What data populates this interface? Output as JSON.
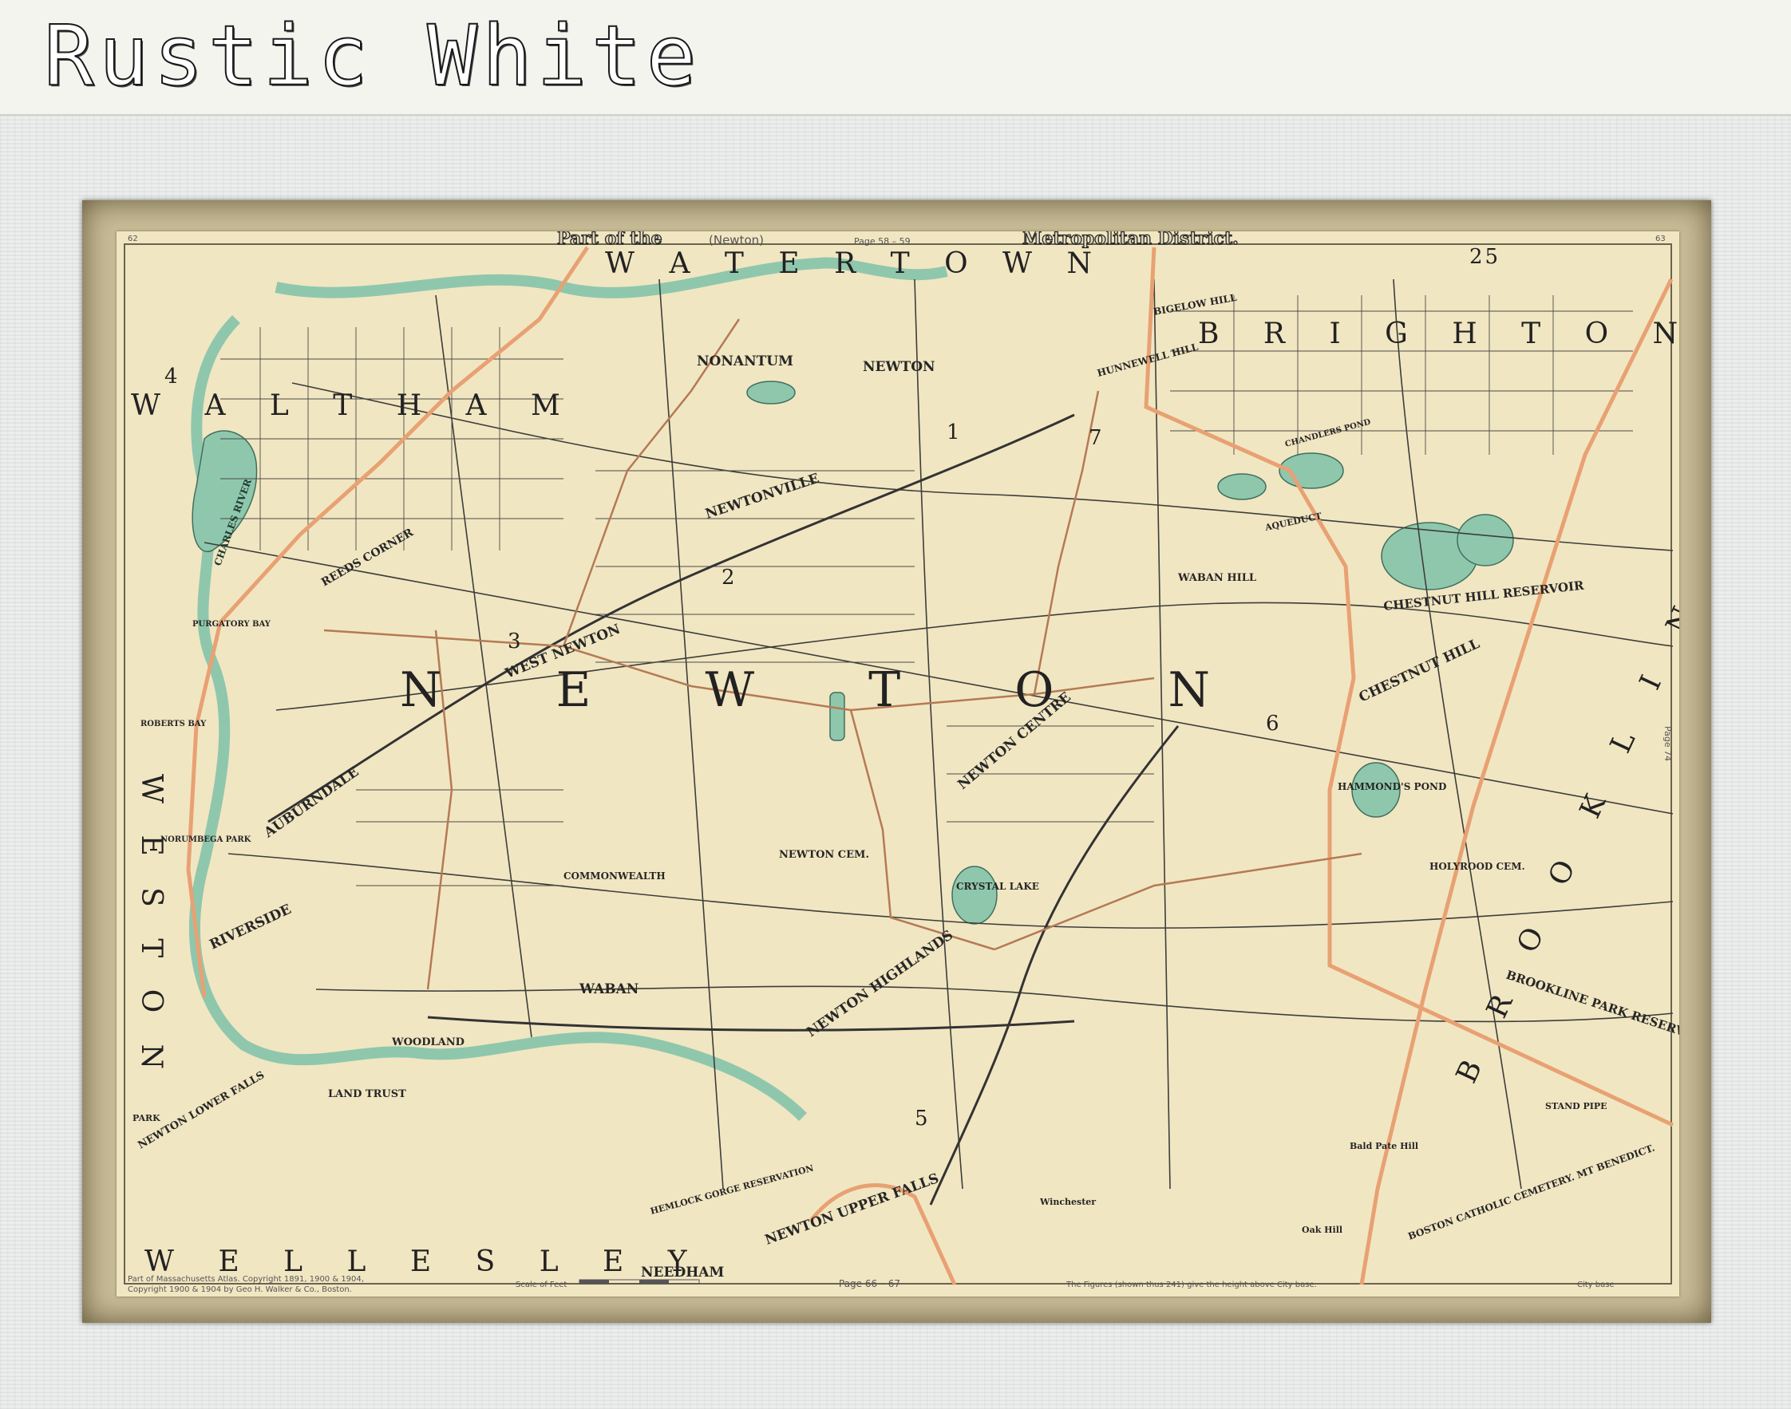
{
  "product": {
    "title": "Rustic White"
  },
  "map": {
    "header": {
      "left": "Part of the",
      "middle": "(Newton)",
      "right": "Metropolitan District.",
      "page_ref": "Page 58 – 59",
      "page_left": "62",
      "page_right": "63"
    },
    "side_page_ref": "Page 74",
    "footer": {
      "copyright1": "Part of Massachusetts Atlas. Copyright 1891, 1900 & 1904,",
      "copyright2": "Copyright 1900 & 1904 by Geo H. Walker & Co., Boston.",
      "scale": "Scale of Feet",
      "page": "Page 66 – 67",
      "elevation_note": "The Figures (shown thus 241) give the height above City base.",
      "city_base": "City base"
    },
    "labels": {
      "newton": "N E W T O N",
      "watertown": "W A T E R T O W N",
      "brighton": "B R I G H T O N",
      "waltham": "W A L T H A M",
      "weston": "W E S T O N",
      "wellesley": "W E L L E S L E Y",
      "brookline": "B R O O K L I N E",
      "nonantum": "NONANTUM",
      "newtonville": "NEWTONVILLE",
      "west_newton": "WEST NEWTON",
      "newton_village": "NEWTON",
      "newton_centre": "NEWTON CENTRE",
      "auburndale": "AUBURNDALE",
      "riverside": "RIVERSIDE",
      "waban": "WABAN",
      "newton_highlands": "NEWTON HIGHLANDS",
      "newton_upper_falls": "NEWTON UPPER FALLS",
      "newton_lower_falls": "NEWTON LOWER FALLS",
      "chestnut_hill": "CHESTNUT HILL",
      "chestnut_hill_reservoir": "CHESTNUT HILL RESERVOIR",
      "waban_hill": "WABAN HILL",
      "crystal_lake": "CRYSTAL LAKE",
      "hammonds_pond": "HAMMOND'S POND",
      "newton_cem": "NEWTON CEM.",
      "holyrood_cem": "HOLYROOD CEM.",
      "brookline_park": "BROOKLINE PARK RESERVATION",
      "boston_catholic": "BOSTON CATHOLIC CEMETERY. MT BENEDICT.",
      "needham": "NEEDHAM",
      "hemlock_gorge": "HEMLOCK GORGE RESERVATION",
      "reeds_corner": "REEDS CORNER",
      "charles_river": "CHARLES RIVER",
      "commonwealth": "COMMONWEALTH",
      "aqueduct": "AQUEDUCT",
      "woodland": "WOODLAND",
      "land_trust": "LAND TRUST",
      "bald_pate_hill": "Bald Pate Hill",
      "oak_hill": "Oak Hill",
      "hunnewell_hill": "HUNNEWELL HILL",
      "bigelow_hill": "BIGELOW HILL",
      "stand_pipe": "STAND PIPE",
      "chandlers_pond": "CHANDLERS POND",
      "roberts_bay": "ROBERTS BAY",
      "purgatory_bay": "PURGATORY BAY",
      "norumbega_park": "NORUMBEGA PARK",
      "park": "PARK",
      "winchester": "Winchester"
    },
    "ward_numbers": [
      "1",
      "2",
      "3",
      "4",
      "5",
      "6",
      "7",
      "25"
    ]
  }
}
